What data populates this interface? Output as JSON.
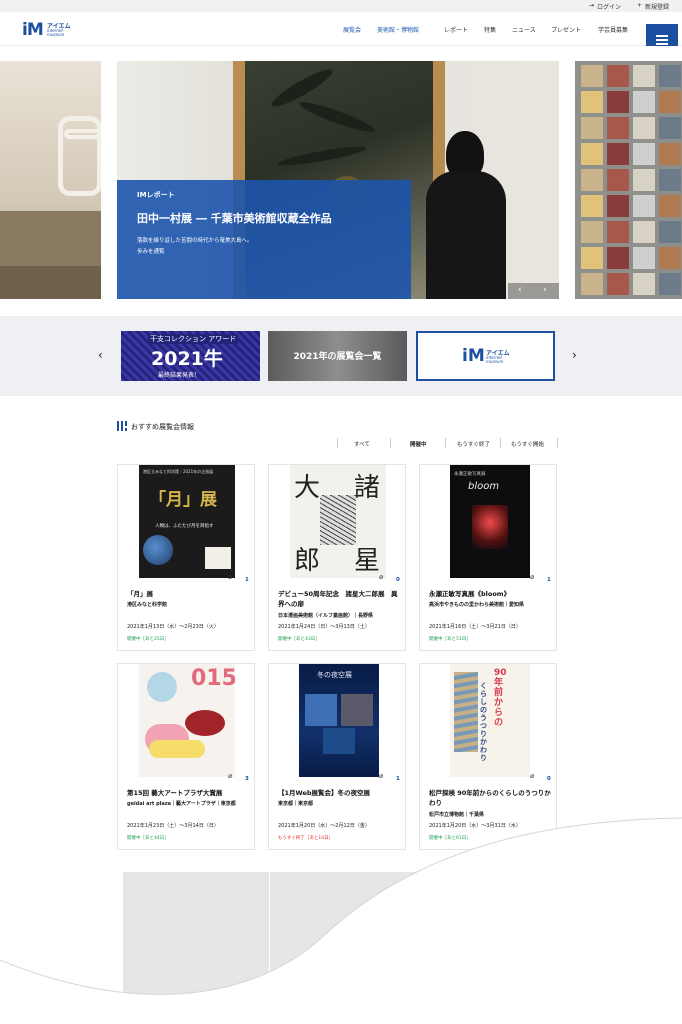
{
  "util": {
    "login": "ログイン",
    "register": "新規登録"
  },
  "header": {
    "logo_mark": "iM",
    "logo_kana": "アイエム",
    "logo_sub1": "internet",
    "logo_sub2": "museum",
    "nav": [
      "展覧会",
      "美術館・博物館",
      "レポート",
      "特集",
      "ニュース",
      "プレゼント",
      "学芸員募集"
    ]
  },
  "hero": {
    "tag": "IMレポート",
    "title": "田中一村展 ― 千葉市美術館収蔵全作品",
    "desc_line1": "落款を繰り返した苦闘の時代から奄美大島へ。",
    "desc_line2": "歩みを通覧",
    "prev": "‹",
    "next": "›"
  },
  "banners": {
    "b1_top": "干支コレクション アワード",
    "b1_main": "2021牛",
    "b1_bottom": "最終結果発表！",
    "b2_text": "2021年の展覧会一覧",
    "b3_mark": "iM",
    "b3_kana": "アイエム",
    "b3_sub1": "internet",
    "b3_sub2": "museum",
    "prev": "‹",
    "next": "›"
  },
  "section": {
    "title": "おすすめ展覧会情報",
    "filters": [
      "すべて",
      "開催中",
      "もうすぐ終了",
      "もうすぐ開始"
    ]
  },
  "cards": [
    {
      "title": "「月」展",
      "venue": "港区みなと科学館",
      "date": "2021年1月13日（水）〜2月23日（火）",
      "status": "開催中［あと25日］",
      "count": "1"
    },
    {
      "title": "デビュー50周年記念　諸星大二郎展　異界への扉",
      "venue": "日本漫画美術館（イルフ童画館）｜長野県",
      "date": "2021年1月24日（日）〜3月13日（土）",
      "status": "開催中［あと43日］",
      "count": "0"
    },
    {
      "title": "永瀬正敏写真展《bloom》",
      "venue": "高浜市やきものの里かわら美術館｜愛知県",
      "date": "2021年1月16日（土）〜3月21日（日）",
      "status": "開催中［あと51日］",
      "count": "1"
    },
    {
      "title": "第15回 藝大アートプラザ大賞展",
      "venue": "geidai art plaza｜藝大アートプラザ｜東京都",
      "date": "2021年1月23日（土）〜3月14日（日）",
      "status": "開催中［あと44日］",
      "count": "3"
    },
    {
      "title": "【1月Web展覧会】冬の夜空展",
      "venue": "東京都｜東京都",
      "date": "2021年1月20日（水）〜2月12日（金）",
      "status": "もうすぐ終了［あと14日］",
      "count": "1"
    },
    {
      "title": "松戸探検 90年前からのくらしのうつりかわり",
      "venue": "松戸市立博物館｜千葉県",
      "date": "2021年1月20日（水）〜3月31日（水）",
      "status": "開催中［あと61日］",
      "count": "0"
    }
  ],
  "posters": {
    "p1_big": "「月」展",
    "p1_head": "港区立みなと科学館｜2021年の企画展",
    "p1_sub": "人類は、ふたたび月を目指す",
    "p2_a": "諸",
    "p2_b": "大",
    "p2_c": "星",
    "p2_d": "郎",
    "p3_word": "bloom",
    "p3_head": "永瀬正敏写真展",
    "p4_num": "015",
    "p5_title": "冬の夜空展",
    "p6_big": "90年前からの",
    "p6_sub": "くらしのうつりかわり"
  },
  "colors": {
    "brand": "#1c4fa0",
    "open": "#1aa04e",
    "ending": "#e0352b"
  }
}
